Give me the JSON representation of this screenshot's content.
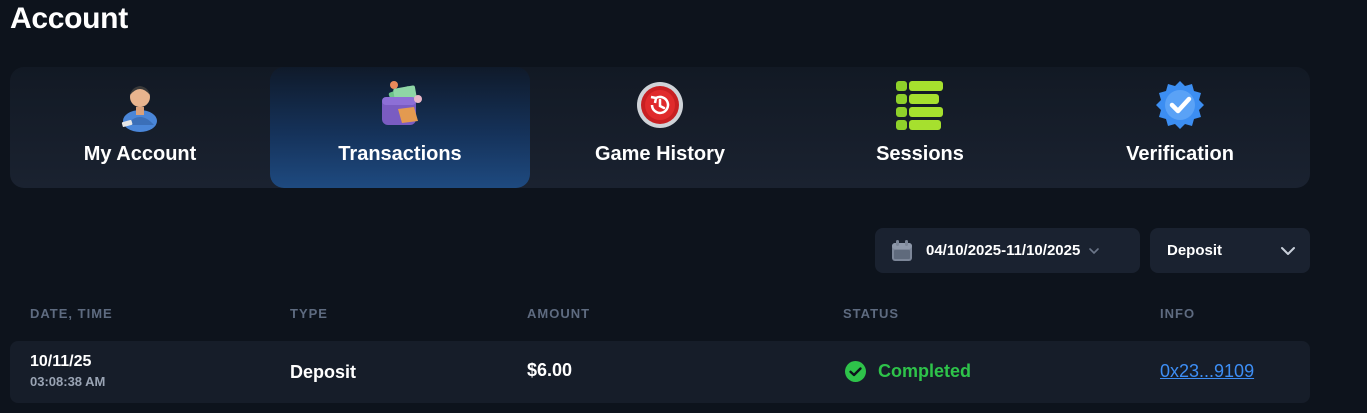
{
  "page": {
    "title": "Account"
  },
  "tabs": [
    {
      "label": "My Account",
      "icon": "user-icon",
      "active": false
    },
    {
      "label": "Transactions",
      "icon": "wallet-icon",
      "active": true
    },
    {
      "label": "Game History",
      "icon": "history-clock-icon",
      "active": false
    },
    {
      "label": "Sessions",
      "icon": "list-icon",
      "active": false
    },
    {
      "label": "Verification",
      "icon": "verified-badge-icon",
      "active": false
    }
  ],
  "filters": {
    "date_range": "04/10/2025-11/10/2025",
    "type": "Deposit"
  },
  "table": {
    "headers": {
      "date_time": "DATE, TIME",
      "type": "TYPE",
      "amount": "AMOUNT",
      "status": "STATUS",
      "info": "INFO"
    },
    "rows": [
      {
        "date": "10/11/25",
        "time": "03:08:38 AM",
        "type": "Deposit",
        "amount": "$6.00",
        "status": "Completed",
        "info": "0x23...9109"
      }
    ]
  },
  "colors": {
    "background": "#0d131c",
    "panel": "#1a2230",
    "active_tab": "#1e4a80",
    "status_completed": "#2ec34a",
    "link": "#3d8ef5",
    "header_text": "#5e6b80"
  }
}
